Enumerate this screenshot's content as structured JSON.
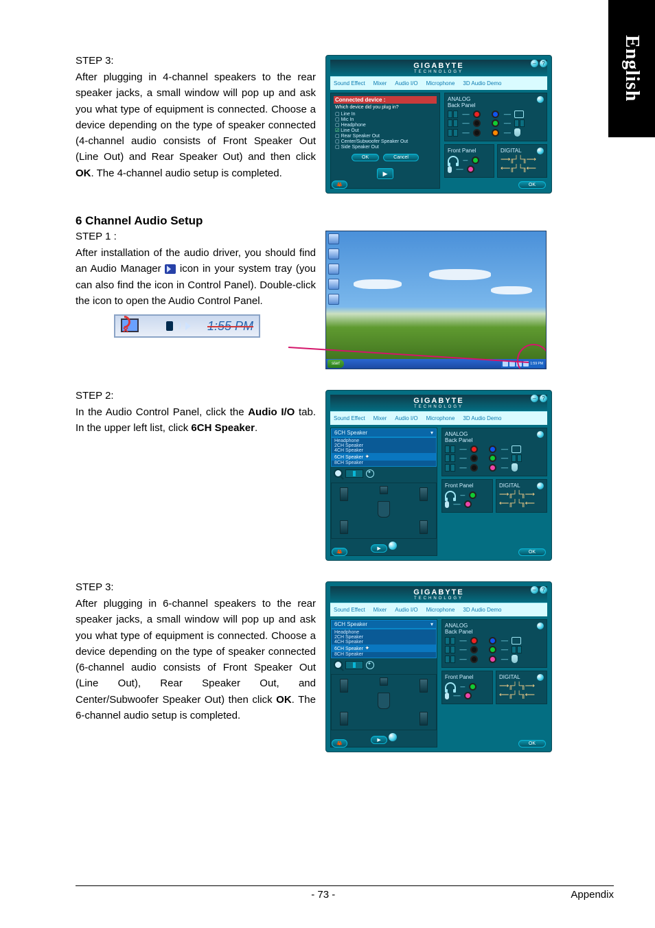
{
  "sideTab": "English",
  "step3a": {
    "label": "STEP 3:",
    "text_pre": "After plugging in 4-channel speakers to the rear speaker jacks, a small window will pop up and ask you what type of equipment is connected. Choose a device depending on the type of speaker connected (4-channel audio consists of Front Speaker Out (Line Out) and Rear Speaker Out) and then click ",
    "ok": "OK",
    "text_post": ". The 4-channel audio setup is completed."
  },
  "section_header": "6 Channel Audio Setup",
  "step1b": {
    "label": "STEP 1 :",
    "text_pre": "After installation of the audio driver, you should find an Audio Manager",
    "text_post": " icon in your system tray (you can also find the icon in Control Panel).  Double-click the icon to open the Audio Control Panel."
  },
  "tray": {
    "time": "1:55 PM"
  },
  "desktop": {
    "start": "start",
    "tray_time": "1:59 PM"
  },
  "step2c": {
    "label": "STEP 2:",
    "text_pre": "In the Audio Control Panel, click the ",
    "tab": "Audio I/O",
    "text_mid": " tab. In the upper left list, click ",
    "sel": "6CH Speaker",
    "text_post": "."
  },
  "step3c": {
    "label": "STEP 3:",
    "text_pre": "After plugging in 6-channel speakers to the rear speaker jacks, a small window will pop up and ask you what type of equipment is connected. Choose a device depending on the type of speaker connected (6-channel audio consists of Front Speaker Out (Line Out), Rear Speaker Out, and Center/Subwoofer Speaker Out) then click ",
    "ok": "OK",
    "text_post": ". The 6-channel audio setup is completed."
  },
  "panel": {
    "brand": "GIGABYTE",
    "brand_sub": "TECHNOLOGY",
    "tabs": [
      "Sound Effect",
      "Mixer",
      "Audio I/O",
      "Microphone",
      "3D Audio Demo"
    ],
    "analog_label": "ANALOG",
    "back_panel_label": "Back Panel",
    "front_panel_label": "Front Panel",
    "digital_label": "DIGITAL",
    "ok_btn": "OK",
    "cancel_btn": "Cancel",
    "play": "▶"
  },
  "device_dialog": {
    "title": "Connected device :",
    "question": "Which device did you plug in?",
    "options": [
      "Line In",
      "Mic In",
      "Headphone",
      "Line Out",
      "Rear Speaker Out",
      "Center/Subwoofer Speaker Out",
      "Side Speaker Out"
    ],
    "checked_index": 3
  },
  "speaker_dropdown": {
    "selected_6": "6CH Speaker",
    "options": [
      "Headphone",
      "2CH Speaker",
      "4CH Speaker",
      "6CH Speaker",
      "8CH Speaker"
    ]
  },
  "footer": {
    "page": "- 73 -",
    "section": "Appendix"
  }
}
